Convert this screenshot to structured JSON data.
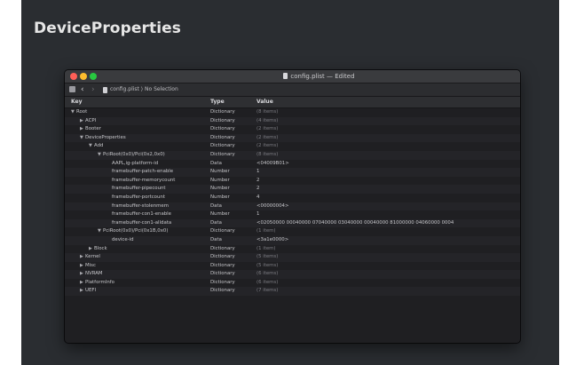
{
  "page": {
    "title": "DeviceProperties"
  },
  "window": {
    "title": "config.plist — Edited",
    "breadcrumb": "config.plist ⟩ No Selection",
    "back_glyph": "‹",
    "forward_glyph": "›"
  },
  "table": {
    "headers": {
      "key": "Key",
      "type": "Type",
      "value": "Value"
    },
    "rows": [
      {
        "key": "Root",
        "indent": 0,
        "disclosure": "open",
        "type": "Dictionary",
        "value": "(8 items)",
        "dim": true
      },
      {
        "key": "ACPI",
        "indent": 1,
        "disclosure": "closed",
        "type": "Dictionary",
        "value": "(4 items)",
        "dim": true
      },
      {
        "key": "Booter",
        "indent": 1,
        "disclosure": "closed",
        "type": "Dictionary",
        "value": "(2 items)",
        "dim": true
      },
      {
        "key": "DeviceProperties",
        "indent": 1,
        "disclosure": "open",
        "type": "Dictionary",
        "value": "(2 items)",
        "dim": true
      },
      {
        "key": "Add",
        "indent": 2,
        "disclosure": "open",
        "type": "Dictionary",
        "value": "(2 items)",
        "dim": true
      },
      {
        "key": "PciRoot(0x0)/Pci(0x2,0x0)",
        "indent": 3,
        "disclosure": "open",
        "type": "Dictionary",
        "value": "(8 items)",
        "dim": true
      },
      {
        "key": "AAPL,ig-platform-id",
        "indent": 4,
        "disclosure": "none",
        "type": "Data",
        "value": "<04009B01>",
        "dim": false
      },
      {
        "key": "framebuffer-patch-enable",
        "indent": 4,
        "disclosure": "none",
        "type": "Number",
        "value": "1",
        "dim": false
      },
      {
        "key": "framebuffer-memorycount",
        "indent": 4,
        "disclosure": "none",
        "type": "Number",
        "value": "2",
        "dim": false
      },
      {
        "key": "framebuffer-pipecount",
        "indent": 4,
        "disclosure": "none",
        "type": "Number",
        "value": "2",
        "dim": false
      },
      {
        "key": "framebuffer-portcount",
        "indent": 4,
        "disclosure": "none",
        "type": "Number",
        "value": "4",
        "dim": false
      },
      {
        "key": "framebuffer-stolenmem",
        "indent": 4,
        "disclosure": "none",
        "type": "Data",
        "value": "<00000004>",
        "dim": false
      },
      {
        "key": "framebuffer-con1-enable",
        "indent": 4,
        "disclosure": "none",
        "type": "Number",
        "value": "1",
        "dim": false
      },
      {
        "key": "framebuffer-con1-alldata",
        "indent": 4,
        "disclosure": "none",
        "type": "Data",
        "value": "<02050000 00040000 07040000 03040000 00040000 81000000 04060000 0004",
        "dim": false
      },
      {
        "key": "PciRoot(0x0)/Pci(0x1B,0x0)",
        "indent": 3,
        "disclosure": "open",
        "type": "Dictionary",
        "value": "(1 item)",
        "dim": true
      },
      {
        "key": "device-id",
        "indent": 4,
        "disclosure": "none",
        "type": "Data",
        "value": "<3a1e0000>",
        "dim": false
      },
      {
        "key": "Block",
        "indent": 2,
        "disclosure": "closed",
        "type": "Dictionary",
        "value": "(1 item)",
        "dim": true
      },
      {
        "key": "Kernel",
        "indent": 1,
        "disclosure": "closed",
        "type": "Dictionary",
        "value": "(5 items)",
        "dim": true
      },
      {
        "key": "Misc",
        "indent": 1,
        "disclosure": "closed",
        "type": "Dictionary",
        "value": "(5 items)",
        "dim": true
      },
      {
        "key": "NVRAM",
        "indent": 1,
        "disclosure": "closed",
        "type": "Dictionary",
        "value": "(6 items)",
        "dim": true
      },
      {
        "key": "PlatformInfo",
        "indent": 1,
        "disclosure": "closed",
        "type": "Dictionary",
        "value": "(6 items)",
        "dim": true
      },
      {
        "key": "UEFI",
        "indent": 1,
        "disclosure": "closed",
        "type": "Dictionary",
        "value": "(7 items)",
        "dim": true
      }
    ]
  }
}
